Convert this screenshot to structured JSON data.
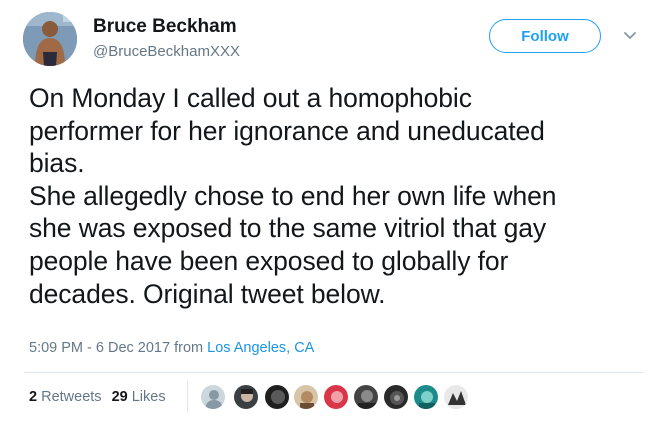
{
  "user": {
    "name": "Bruce Beckham",
    "handle": "@BruceBeckhamXXX",
    "follow_label": "Follow"
  },
  "tweet": {
    "text": "On Monday I called out a homophobic\nperformer for her ignorance and uneducated\nbias.\nShe allegedly chose to end her own life when\nshe was exposed to the same vitriol that gay\npeople have been exposed to globally for\ndecades.  Original tweet below.",
    "timestamp": "5:09 PM - 6 Dec 2017",
    "from_word": "from",
    "location": "Los Angeles, CA"
  },
  "stats": {
    "retweets_count": "2",
    "retweets_label": "Retweets",
    "likes_count": "29",
    "likes_label": "Likes"
  },
  "colors": {
    "accent": "#1da1f2",
    "link": "#1b95e0",
    "muted": "#657786",
    "text": "#14171a"
  },
  "icons": {
    "menu": "chevron-down-icon",
    "likers": [
      "avatar",
      "avatar",
      "avatar",
      "avatar",
      "avatar",
      "avatar",
      "avatar",
      "avatar",
      "avatar"
    ]
  }
}
